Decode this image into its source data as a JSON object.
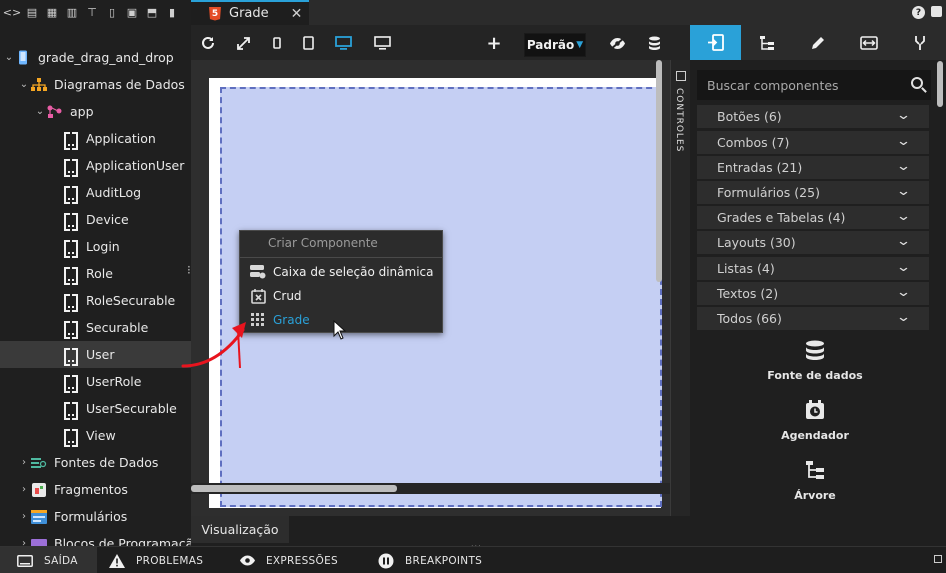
{
  "left_toolbar": {
    "icons": [
      "code-icon",
      "file-icon",
      "layout-icon",
      "table-icon",
      "hierarchy-icon",
      "mobile-icon",
      "server-icon",
      "html5-icon",
      "book-icon"
    ]
  },
  "tree": {
    "items": [
      {
        "label": "grade_drag_and_drop",
        "icon": "mobile-project-icon",
        "expanded": true
      },
      {
        "label": "Diagramas de Dados",
        "icon": "diagram-icon",
        "expanded": true
      },
      {
        "label": "app",
        "icon": "app-icon",
        "expanded": true
      },
      {
        "label": "Application",
        "icon": "entity-icon"
      },
      {
        "label": "ApplicationUser",
        "icon": "entity-icon"
      },
      {
        "label": "AuditLog",
        "icon": "entity-icon"
      },
      {
        "label": "Device",
        "icon": "entity-icon"
      },
      {
        "label": "Login",
        "icon": "entity-icon"
      },
      {
        "label": "Role",
        "icon": "entity-icon"
      },
      {
        "label": "RoleSecurable",
        "icon": "entity-icon"
      },
      {
        "label": "Securable",
        "icon": "entity-icon"
      },
      {
        "label": "User",
        "icon": "entity-icon",
        "selected": true
      },
      {
        "label": "UserRole",
        "icon": "entity-icon"
      },
      {
        "label": "UserSecurable",
        "icon": "entity-icon"
      },
      {
        "label": "View",
        "icon": "entity-icon"
      },
      {
        "label": "Fontes de Dados",
        "icon": "datasource-icon",
        "expanded": false
      },
      {
        "label": "Fragmentos",
        "icon": "fragment-icon",
        "expanded": false
      },
      {
        "label": "Formulários",
        "icon": "form-icon",
        "expanded": false
      },
      {
        "label": "Blocos de Programação",
        "icon": "blocks-icon",
        "expanded": false
      }
    ]
  },
  "tabs": {
    "active_label": "Grade",
    "close_glyph": "✕"
  },
  "editor_toolbar": {
    "zoom_value": "Padrão"
  },
  "context_menu": {
    "title": "Criar Componente",
    "items": [
      {
        "label": "Caixa de seleção dinâmica",
        "icon": "dynamic-combo-icon"
      },
      {
        "label": "Crud",
        "icon": "crud-icon"
      },
      {
        "label": "Grade",
        "icon": "grid-icon",
        "highlighted": true
      }
    ]
  },
  "controls_tab": {
    "label": "CONTROLES"
  },
  "right_panel": {
    "tabs": [
      "entity-tab-icon",
      "tree-tab-icon",
      "pencil-tab-icon",
      "swap-tab-icon",
      "bindings-tab-icon"
    ],
    "search": {
      "placeholder": "Buscar componentes",
      "value": ""
    },
    "categories": [
      {
        "label": "Botões (6)"
      },
      {
        "label": "Combos (7)"
      },
      {
        "label": "Entradas (21)"
      },
      {
        "label": "Formulários (25)"
      },
      {
        "label": "Grades e Tabelas (4)"
      },
      {
        "label": "Layouts (30)"
      },
      {
        "label": "Listas (4)"
      },
      {
        "label": "Textos (2)"
      },
      {
        "label": "Todos (66)"
      }
    ],
    "components": [
      {
        "label": "Fonte de dados",
        "icon": "database-icon"
      },
      {
        "label": "Agendador",
        "icon": "scheduler-icon"
      },
      {
        "label": "Árvore",
        "icon": "tree-icon"
      }
    ]
  },
  "bottom": {
    "visualization_tab": "Visualização"
  },
  "status_bar": {
    "items": [
      {
        "label": "SAÍDA",
        "icon": "output-icon",
        "active": true
      },
      {
        "label": "PROBLEMAS",
        "icon": "warning-icon"
      },
      {
        "label": "EXPRESSÕES",
        "icon": "eye-icon"
      },
      {
        "label": "BREAKPOINTS",
        "icon": "pause-icon"
      }
    ]
  },
  "colors": {
    "accent": "#2aa1d8",
    "canvas_grid": "#c5cff3",
    "arrow": "#e8141e"
  }
}
